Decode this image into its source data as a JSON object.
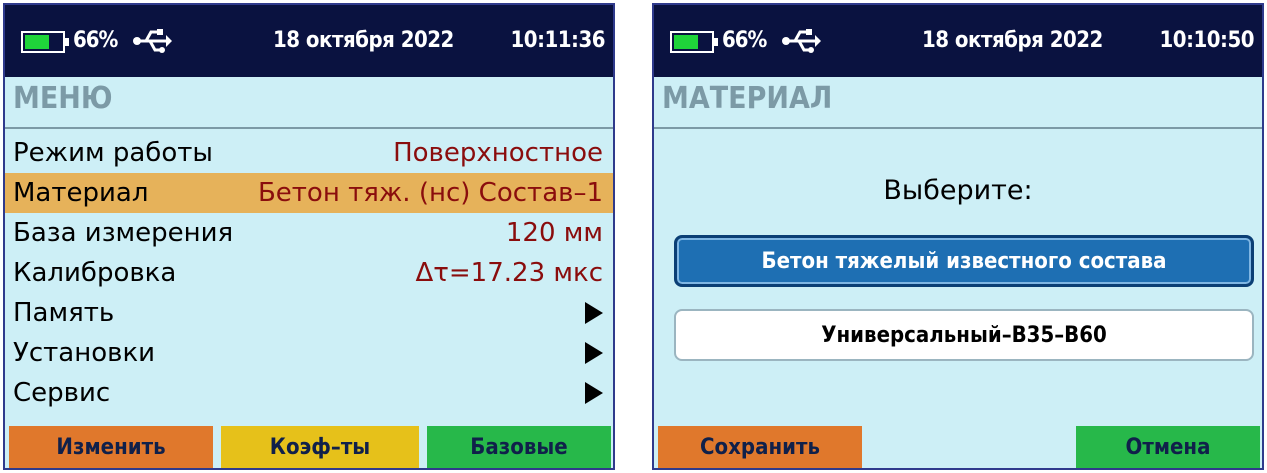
{
  "status": {
    "battery_percent": "66%",
    "battery_level": 0.66,
    "date": "18 октября 2022",
    "time_left": "10:11:36",
    "time_right": "10:10:50",
    "icons": [
      "battery-icon",
      "usb-icon"
    ]
  },
  "left_screen": {
    "title": "МЕНЮ",
    "items": [
      {
        "label": "Режим работы",
        "value": "Поверхностное"
      },
      {
        "label": "Материал",
        "value": "Бетон тяж. (нс) Состав–1"
      },
      {
        "label": "База измерения",
        "value": "120 мм"
      },
      {
        "label": "Калибровка",
        "value": "Δτ=17.23 мкс"
      },
      {
        "label": "Память",
        "value": ""
      },
      {
        "label": "Установки",
        "value": ""
      },
      {
        "label": "Сервис",
        "value": ""
      }
    ],
    "selected_index": 1,
    "softkeys": {
      "change": "Изменить",
      "coefs": "Коэф–ты",
      "base": "Базовые"
    }
  },
  "right_screen": {
    "title": "МАТЕРИАЛ",
    "prompt": "Выберите:",
    "options": [
      "Бетон тяжелый известного состава",
      "Универсальный–B35–B60"
    ],
    "selected_index": 0,
    "softkeys": {
      "save": "Сохранить",
      "cancel": "Отмена"
    }
  },
  "colors": {
    "screen_bg": "#cdeff6",
    "status_bg": "#0a1240",
    "selection": "#e6b25a",
    "value_text": "#8a0d0d",
    "softkey_orange": "#e0782c",
    "softkey_yellow": "#e6c11a",
    "softkey_green": "#27b84a",
    "option_active": "#1e6fb3"
  }
}
